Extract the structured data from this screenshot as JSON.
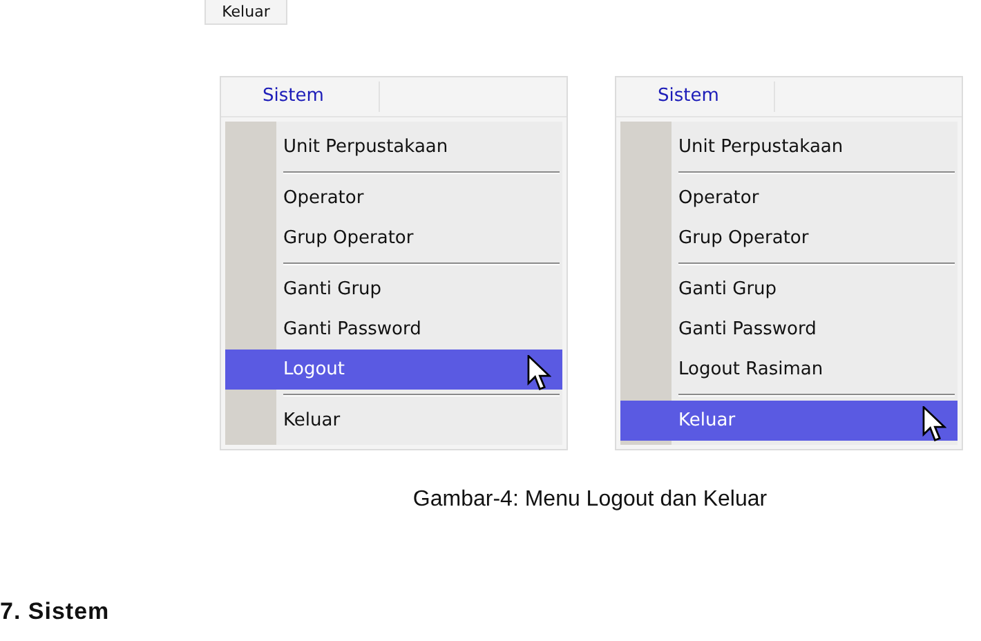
{
  "button": {
    "label": "Keluar"
  },
  "figures": [
    {
      "menu_title": "Sistem",
      "items": [
        {
          "kind": "item",
          "label": "Unit Perpustakaan",
          "selected": false
        },
        {
          "kind": "separator"
        },
        {
          "kind": "item",
          "label": "Operator",
          "selected": false
        },
        {
          "kind": "item",
          "label": "Grup Operator",
          "selected": false
        },
        {
          "kind": "separator"
        },
        {
          "kind": "item",
          "label": "Ganti Grup",
          "selected": false
        },
        {
          "kind": "item",
          "label": "Ganti Password",
          "selected": false
        },
        {
          "kind": "item",
          "label": "Logout",
          "selected": true
        },
        {
          "kind": "separator"
        },
        {
          "kind": "item",
          "label": "Keluar",
          "selected": false
        }
      ]
    },
    {
      "menu_title": "Sistem",
      "items": [
        {
          "kind": "item",
          "label": "Unit Perpustakaan",
          "selected": false
        },
        {
          "kind": "separator"
        },
        {
          "kind": "item",
          "label": "Operator",
          "selected": false
        },
        {
          "kind": "item",
          "label": "Grup Operator",
          "selected": false
        },
        {
          "kind": "separator"
        },
        {
          "kind": "item",
          "label": "Ganti Grup",
          "selected": false
        },
        {
          "kind": "item",
          "label": "Ganti Password",
          "selected": false
        },
        {
          "kind": "item",
          "label": "Logout Rasiman",
          "selected": false
        },
        {
          "kind": "separator"
        },
        {
          "kind": "item",
          "label": "Keluar",
          "selected": true
        }
      ]
    }
  ],
  "caption": "Gambar-4: Menu Logout dan Keluar",
  "heading": "7. Sistem"
}
